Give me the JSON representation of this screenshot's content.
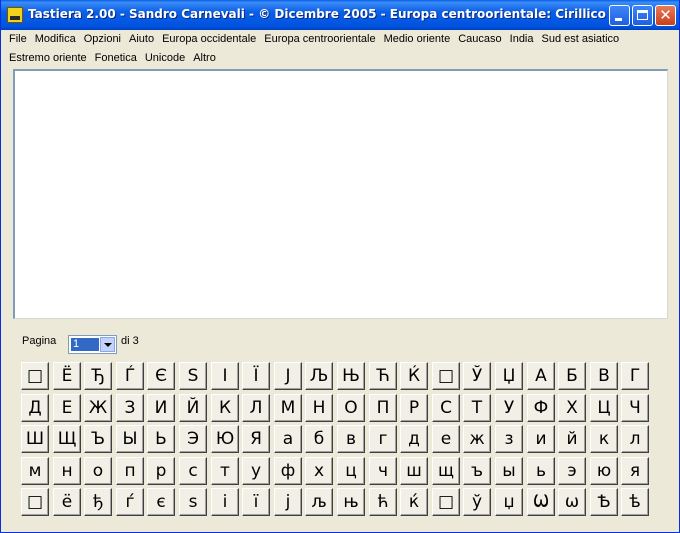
{
  "window": {
    "title": "Tastiera 2.00 - Sandro Carnevali - © Dicembre 2005 - Europa centroorientale: Cirillico",
    "minimize_label": "",
    "maximize_label": "",
    "close_label": "✕"
  },
  "menu": {
    "row1": [
      "File",
      "Modifica",
      "Opzioni",
      "Aiuto",
      "Europa occidentale",
      "Europa centroorientale",
      "Medio oriente",
      "Caucaso",
      "India",
      "Sud est asiatico"
    ],
    "row2": [
      "Estremo oriente",
      "Fonetica",
      "Unicode",
      "Altro"
    ]
  },
  "editor": {
    "text": ""
  },
  "pager": {
    "label": "Pagina",
    "selected": "1",
    "of_text": "di 3"
  },
  "keyboard": {
    "rows": [
      [
        "□",
        "Ё",
        "Ђ",
        "Ѓ",
        "Є",
        "S",
        "І",
        "Ї",
        "J",
        "Љ",
        "Њ",
        "Ћ",
        "Ќ",
        "□",
        "Ў",
        "Џ",
        "А",
        "Б",
        "В",
        "Г"
      ],
      [
        "Д",
        "Е",
        "Ж",
        "З",
        "И",
        "Й",
        "К",
        "Л",
        "М",
        "Н",
        "О",
        "П",
        "Р",
        "С",
        "Т",
        "У",
        "Ф",
        "Х",
        "Ц",
        "Ч"
      ],
      [
        "Ш",
        "Щ",
        "Ъ",
        "Ы",
        "Ь",
        "Э",
        "Ю",
        "Я",
        "а",
        "б",
        "в",
        "г",
        "д",
        "е",
        "ж",
        "з",
        "и",
        "й",
        "к",
        "л"
      ],
      [
        "м",
        "н",
        "о",
        "п",
        "р",
        "с",
        "т",
        "у",
        "ф",
        "х",
        "ц",
        "ч",
        "ш",
        "щ",
        "ъ",
        "ы",
        "ь",
        "э",
        "ю",
        "я"
      ],
      [
        "□",
        "ё",
        "ђ",
        "ѓ",
        "є",
        "s",
        "і",
        "ї",
        "j",
        "љ",
        "њ",
        "ћ",
        "ќ",
        "□",
        "ў",
        "џ",
        "Ѡ",
        "ѡ",
        "Ѣ",
        "ѣ"
      ]
    ]
  },
  "colors": {
    "titlebar": "#0053e0",
    "window_bg": "#ece9d8",
    "key_bg": "#f2f0e6",
    "selection": "#316ac5"
  }
}
